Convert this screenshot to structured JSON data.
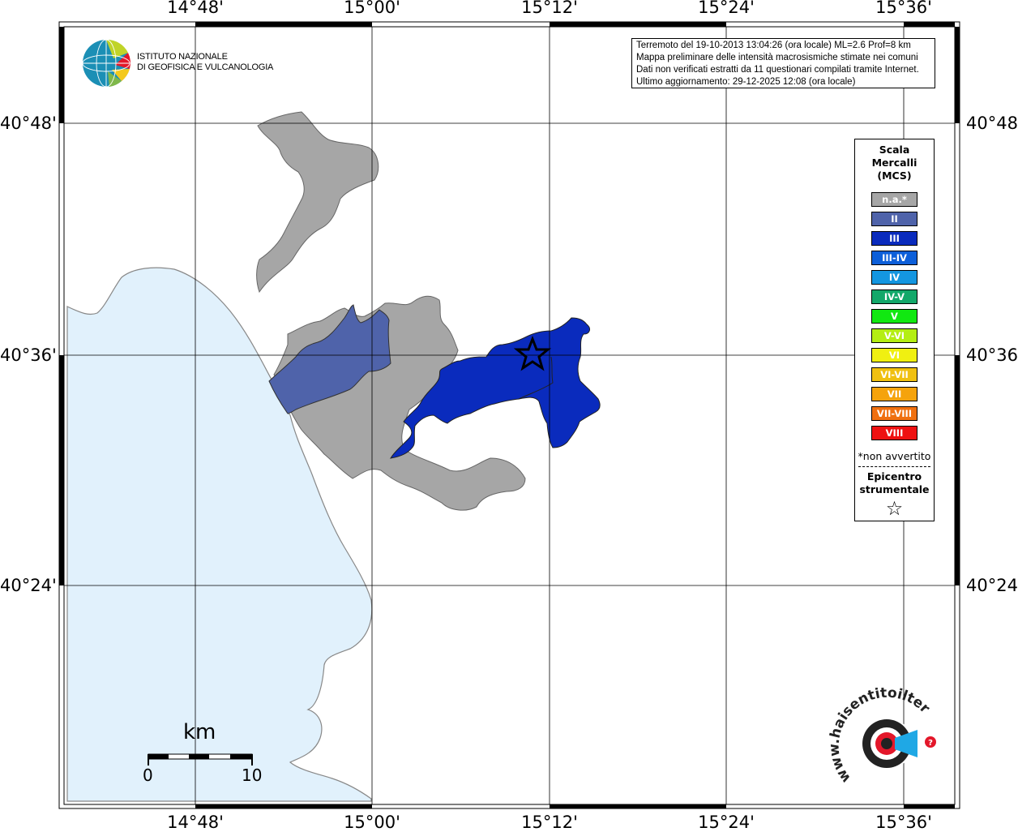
{
  "map": {
    "top_labels": [
      "14°48'",
      "15°00'",
      "15°12'",
      "15°24'",
      "15°36'"
    ],
    "bottom_labels": [
      "14°48'",
      "15°00'",
      "15°12'",
      "15°24'",
      "15°36'"
    ],
    "left_labels": [
      "40°48'",
      "40°36'",
      "40°24'"
    ],
    "right_labels": [
      "40°48'",
      "40°36'",
      "40°24'"
    ]
  },
  "info": {
    "line1": "Terremoto del 19-10-2013 13:04:26 (ora locale) ML=2.6 Prof=8 km",
    "line2": "Mappa preliminare delle intensità macrosismiche stimate nei comuni",
    "line3": "Dati non verificati estratti da 11 questionari compilati tramite Internet.",
    "line4": "Ultimo aggiornamento: 29-12-2025 12:08 (ora locale)"
  },
  "logo": {
    "line1": "ISTITUTO NAZIONALE",
    "line2": "DI GEOFISICA E VULCANOLOGIA"
  },
  "legend": {
    "title_line1": "Scala",
    "title_line2": "Mercalli",
    "title_line3": "(MCS)",
    "items": [
      {
        "label": "n.a.*",
        "color": "#a6a6a6"
      },
      {
        "label": "II",
        "color": "#4f63aa"
      },
      {
        "label": "III",
        "color": "#0a2bbd"
      },
      {
        "label": "III-IV",
        "color": "#0d5fd9"
      },
      {
        "label": "IV",
        "color": "#1496e0"
      },
      {
        "label": "IV-V",
        "color": "#13a86a"
      },
      {
        "label": "V",
        "color": "#11e811"
      },
      {
        "label": "V-VI",
        "color": "#b4ee13"
      },
      {
        "label": "VI",
        "color": "#f0f011"
      },
      {
        "label": "VI-VII",
        "color": "#f0c011"
      },
      {
        "label": "VII",
        "color": "#f5a30c"
      },
      {
        "label": "VII-VIII",
        "color": "#f07010"
      },
      {
        "label": "VIII",
        "color": "#ee1111"
      }
    ],
    "note": "*non avvertito",
    "epicentre_line1": "Epicentro",
    "epicentre_line2": "strumentale",
    "star_symbol": "☆"
  },
  "scalebar": {
    "unit": "km",
    "min": "0",
    "max": "10"
  },
  "hst_logo": {
    "text": "haisentitoilterremoto.it",
    "prefix": "www."
  },
  "colors": {
    "sea": "#e1f1fc",
    "land_na": "#a6a6a6",
    "intensity_ii": "#4f63aa",
    "intensity_iii": "#0a2bbd"
  }
}
